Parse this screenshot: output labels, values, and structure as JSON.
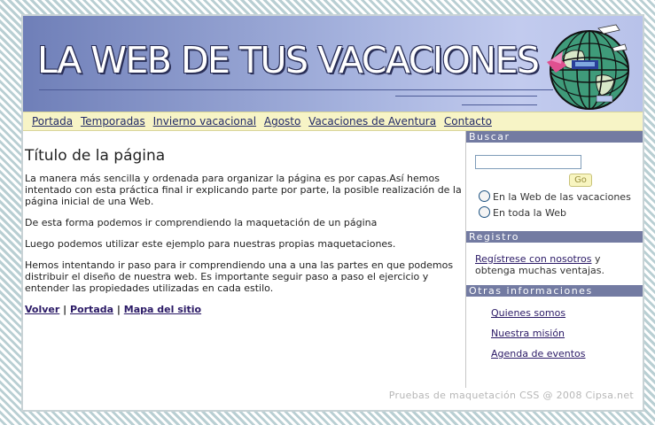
{
  "header": {
    "title": "LA WEB DE TUS VACACIONES"
  },
  "nav": [
    {
      "label": "Portada"
    },
    {
      "label": "Temporadas"
    },
    {
      "label": "Invierno vacacional"
    },
    {
      "label": "Agosto"
    },
    {
      "label": "Vacaciones de Aventura"
    },
    {
      "label": "Contacto"
    }
  ],
  "content": {
    "title": "Título de la página",
    "paragraphs": [
      "La manera más sencilla y ordenada para organizar la página es por capas.Así hemos intentado con esta práctica final ir explicando parte por parte, la posible realización de la página inicial de una Web.",
      "De esta forma podemos ir comprendiendo la maquetación de un página",
      "Luego podemos utilizar este ejemplo para nuestras propias maquetaciones.",
      "Hemos intentando ir paso para ir comprendiendo una a una las partes en que podemos distribuir el diseño de nuestra web. Es importante seguir paso a paso el ejercicio y entender las propiedades utilizadas en cada estilo."
    ],
    "links": {
      "back": "Volver",
      "home": "Portada",
      "sitemap": "Mapa del sitio",
      "separator": "|"
    }
  },
  "sidebar": {
    "search": {
      "heading": "Buscar",
      "input_value": "",
      "go_label": "Go",
      "options": [
        "En la Web de las vacaciones",
        "En toda la Web"
      ]
    },
    "register": {
      "heading": "Registro",
      "link": "Regístrese con nosotros",
      "text": " y obtenga muchas ventajas."
    },
    "info": {
      "heading": "Otras informaciones",
      "links": [
        "Quienes somos",
        "Nuestra misión",
        "Agenda de eventos"
      ]
    }
  },
  "footer": {
    "text": "Pruebas de maquetación CSS @ 2008 Cipsa.net"
  }
}
